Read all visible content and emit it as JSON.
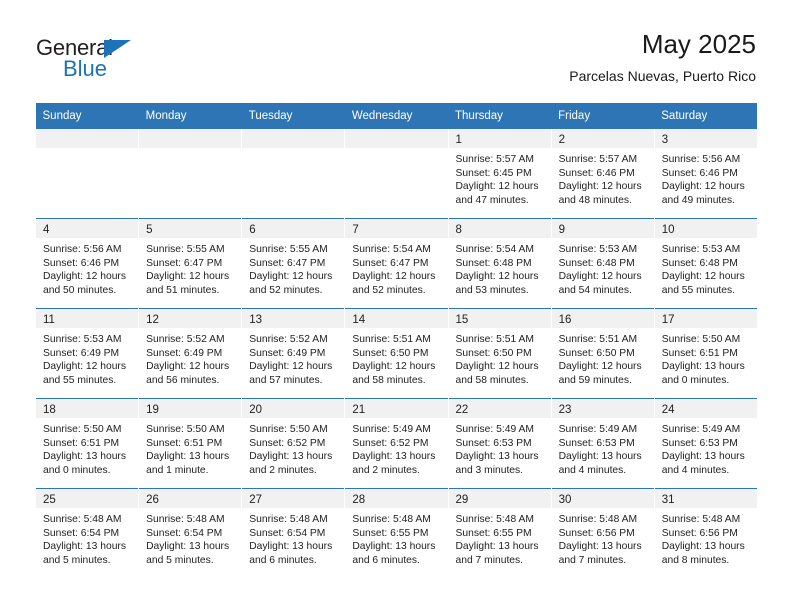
{
  "brand": {
    "name_part1": "General",
    "name_part2": "Blue",
    "triangle_icon": "triangle-icon",
    "accent_color": "#1e72b8"
  },
  "header": {
    "title": "May 2025",
    "subtitle": "Parcelas Nuevas, Puerto Rico",
    "header_bg_color": "#2e75b6",
    "daynum_band_color": "#f1f1f1"
  },
  "weekday_headers": [
    "Sunday",
    "Monday",
    "Tuesday",
    "Wednesday",
    "Thursday",
    "Friday",
    "Saturday"
  ],
  "weeks": [
    [
      {
        "day": "",
        "lines": []
      },
      {
        "day": "",
        "lines": []
      },
      {
        "day": "",
        "lines": []
      },
      {
        "day": "",
        "lines": []
      },
      {
        "day": "1",
        "lines": [
          "Sunrise: 5:57 AM",
          "Sunset: 6:45 PM",
          "Daylight: 12 hours",
          "and 47 minutes."
        ]
      },
      {
        "day": "2",
        "lines": [
          "Sunrise: 5:57 AM",
          "Sunset: 6:46 PM",
          "Daylight: 12 hours",
          "and 48 minutes."
        ]
      },
      {
        "day": "3",
        "lines": [
          "Sunrise: 5:56 AM",
          "Sunset: 6:46 PM",
          "Daylight: 12 hours",
          "and 49 minutes."
        ]
      }
    ],
    [
      {
        "day": "4",
        "lines": [
          "Sunrise: 5:56 AM",
          "Sunset: 6:46 PM",
          "Daylight: 12 hours",
          "and 50 minutes."
        ]
      },
      {
        "day": "5",
        "lines": [
          "Sunrise: 5:55 AM",
          "Sunset: 6:47 PM",
          "Daylight: 12 hours",
          "and 51 minutes."
        ]
      },
      {
        "day": "6",
        "lines": [
          "Sunrise: 5:55 AM",
          "Sunset: 6:47 PM",
          "Daylight: 12 hours",
          "and 52 minutes."
        ]
      },
      {
        "day": "7",
        "lines": [
          "Sunrise: 5:54 AM",
          "Sunset: 6:47 PM",
          "Daylight: 12 hours",
          "and 52 minutes."
        ]
      },
      {
        "day": "8",
        "lines": [
          "Sunrise: 5:54 AM",
          "Sunset: 6:48 PM",
          "Daylight: 12 hours",
          "and 53 minutes."
        ]
      },
      {
        "day": "9",
        "lines": [
          "Sunrise: 5:53 AM",
          "Sunset: 6:48 PM",
          "Daylight: 12 hours",
          "and 54 minutes."
        ]
      },
      {
        "day": "10",
        "lines": [
          "Sunrise: 5:53 AM",
          "Sunset: 6:48 PM",
          "Daylight: 12 hours",
          "and 55 minutes."
        ]
      }
    ],
    [
      {
        "day": "11",
        "lines": [
          "Sunrise: 5:53 AM",
          "Sunset: 6:49 PM",
          "Daylight: 12 hours",
          "and 55 minutes."
        ]
      },
      {
        "day": "12",
        "lines": [
          "Sunrise: 5:52 AM",
          "Sunset: 6:49 PM",
          "Daylight: 12 hours",
          "and 56 minutes."
        ]
      },
      {
        "day": "13",
        "lines": [
          "Sunrise: 5:52 AM",
          "Sunset: 6:49 PM",
          "Daylight: 12 hours",
          "and 57 minutes."
        ]
      },
      {
        "day": "14",
        "lines": [
          "Sunrise: 5:51 AM",
          "Sunset: 6:50 PM",
          "Daylight: 12 hours",
          "and 58 minutes."
        ]
      },
      {
        "day": "15",
        "lines": [
          "Sunrise: 5:51 AM",
          "Sunset: 6:50 PM",
          "Daylight: 12 hours",
          "and 58 minutes."
        ]
      },
      {
        "day": "16",
        "lines": [
          "Sunrise: 5:51 AM",
          "Sunset: 6:50 PM",
          "Daylight: 12 hours",
          "and 59 minutes."
        ]
      },
      {
        "day": "17",
        "lines": [
          "Sunrise: 5:50 AM",
          "Sunset: 6:51 PM",
          "Daylight: 13 hours",
          "and 0 minutes."
        ]
      }
    ],
    [
      {
        "day": "18",
        "lines": [
          "Sunrise: 5:50 AM",
          "Sunset: 6:51 PM",
          "Daylight: 13 hours",
          "and 0 minutes."
        ]
      },
      {
        "day": "19",
        "lines": [
          "Sunrise: 5:50 AM",
          "Sunset: 6:51 PM",
          "Daylight: 13 hours",
          "and 1 minute."
        ]
      },
      {
        "day": "20",
        "lines": [
          "Sunrise: 5:50 AM",
          "Sunset: 6:52 PM",
          "Daylight: 13 hours",
          "and 2 minutes."
        ]
      },
      {
        "day": "21",
        "lines": [
          "Sunrise: 5:49 AM",
          "Sunset: 6:52 PM",
          "Daylight: 13 hours",
          "and 2 minutes."
        ]
      },
      {
        "day": "22",
        "lines": [
          "Sunrise: 5:49 AM",
          "Sunset: 6:53 PM",
          "Daylight: 13 hours",
          "and 3 minutes."
        ]
      },
      {
        "day": "23",
        "lines": [
          "Sunrise: 5:49 AM",
          "Sunset: 6:53 PM",
          "Daylight: 13 hours",
          "and 4 minutes."
        ]
      },
      {
        "day": "24",
        "lines": [
          "Sunrise: 5:49 AM",
          "Sunset: 6:53 PM",
          "Daylight: 13 hours",
          "and 4 minutes."
        ]
      }
    ],
    [
      {
        "day": "25",
        "lines": [
          "Sunrise: 5:48 AM",
          "Sunset: 6:54 PM",
          "Daylight: 13 hours",
          "and 5 minutes."
        ]
      },
      {
        "day": "26",
        "lines": [
          "Sunrise: 5:48 AM",
          "Sunset: 6:54 PM",
          "Daylight: 13 hours",
          "and 5 minutes."
        ]
      },
      {
        "day": "27",
        "lines": [
          "Sunrise: 5:48 AM",
          "Sunset: 6:54 PM",
          "Daylight: 13 hours",
          "and 6 minutes."
        ]
      },
      {
        "day": "28",
        "lines": [
          "Sunrise: 5:48 AM",
          "Sunset: 6:55 PM",
          "Daylight: 13 hours",
          "and 6 minutes."
        ]
      },
      {
        "day": "29",
        "lines": [
          "Sunrise: 5:48 AM",
          "Sunset: 6:55 PM",
          "Daylight: 13 hours",
          "and 7 minutes."
        ]
      },
      {
        "day": "30",
        "lines": [
          "Sunrise: 5:48 AM",
          "Sunset: 6:56 PM",
          "Daylight: 13 hours",
          "and 7 minutes."
        ]
      },
      {
        "day": "31",
        "lines": [
          "Sunrise: 5:48 AM",
          "Sunset: 6:56 PM",
          "Daylight: 13 hours",
          "and 8 minutes."
        ]
      }
    ]
  ]
}
